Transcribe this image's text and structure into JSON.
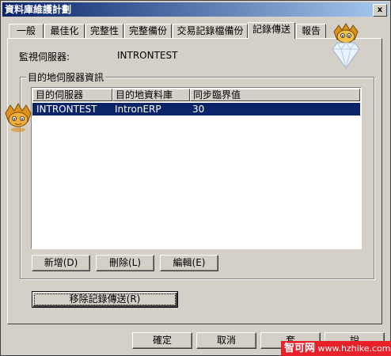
{
  "window": {
    "title": "資料庫維護計劃",
    "close_label": "x"
  },
  "tabs": [
    {
      "label": "一般"
    },
    {
      "label": "最佳化"
    },
    {
      "label": "完整性"
    },
    {
      "label": "完整備份"
    },
    {
      "label": "交易記錄檔備份"
    },
    {
      "label": "記錄傳送",
      "active": true
    },
    {
      "label": "報告"
    }
  ],
  "monitor": {
    "label": "監視伺服器:",
    "value": "INTRONTEST"
  },
  "destination": {
    "group_title": "目的地伺服器資訊",
    "columns": [
      "目的伺服器",
      "目的地資料庫",
      "同步臨界值"
    ],
    "rows": [
      {
        "server": "INTRONTEST",
        "database": "IntronERP",
        "threshold": "30",
        "selected": true
      }
    ],
    "buttons": {
      "add": "新增(D)",
      "delete": "刪除(L)",
      "edit": "編輯(E)"
    }
  },
  "remove_button": "移除記錄傳送(R)",
  "dialog_buttons": {
    "ok": "確定",
    "cancel": "取消",
    "apply": "套",
    "help": "說"
  },
  "watermark": {
    "brand": "智可网",
    "url": "www.hzhike.com"
  },
  "colors": {
    "selection": "#0a246a",
    "face": "#d4d0c8",
    "watermark": "#e8202a"
  }
}
